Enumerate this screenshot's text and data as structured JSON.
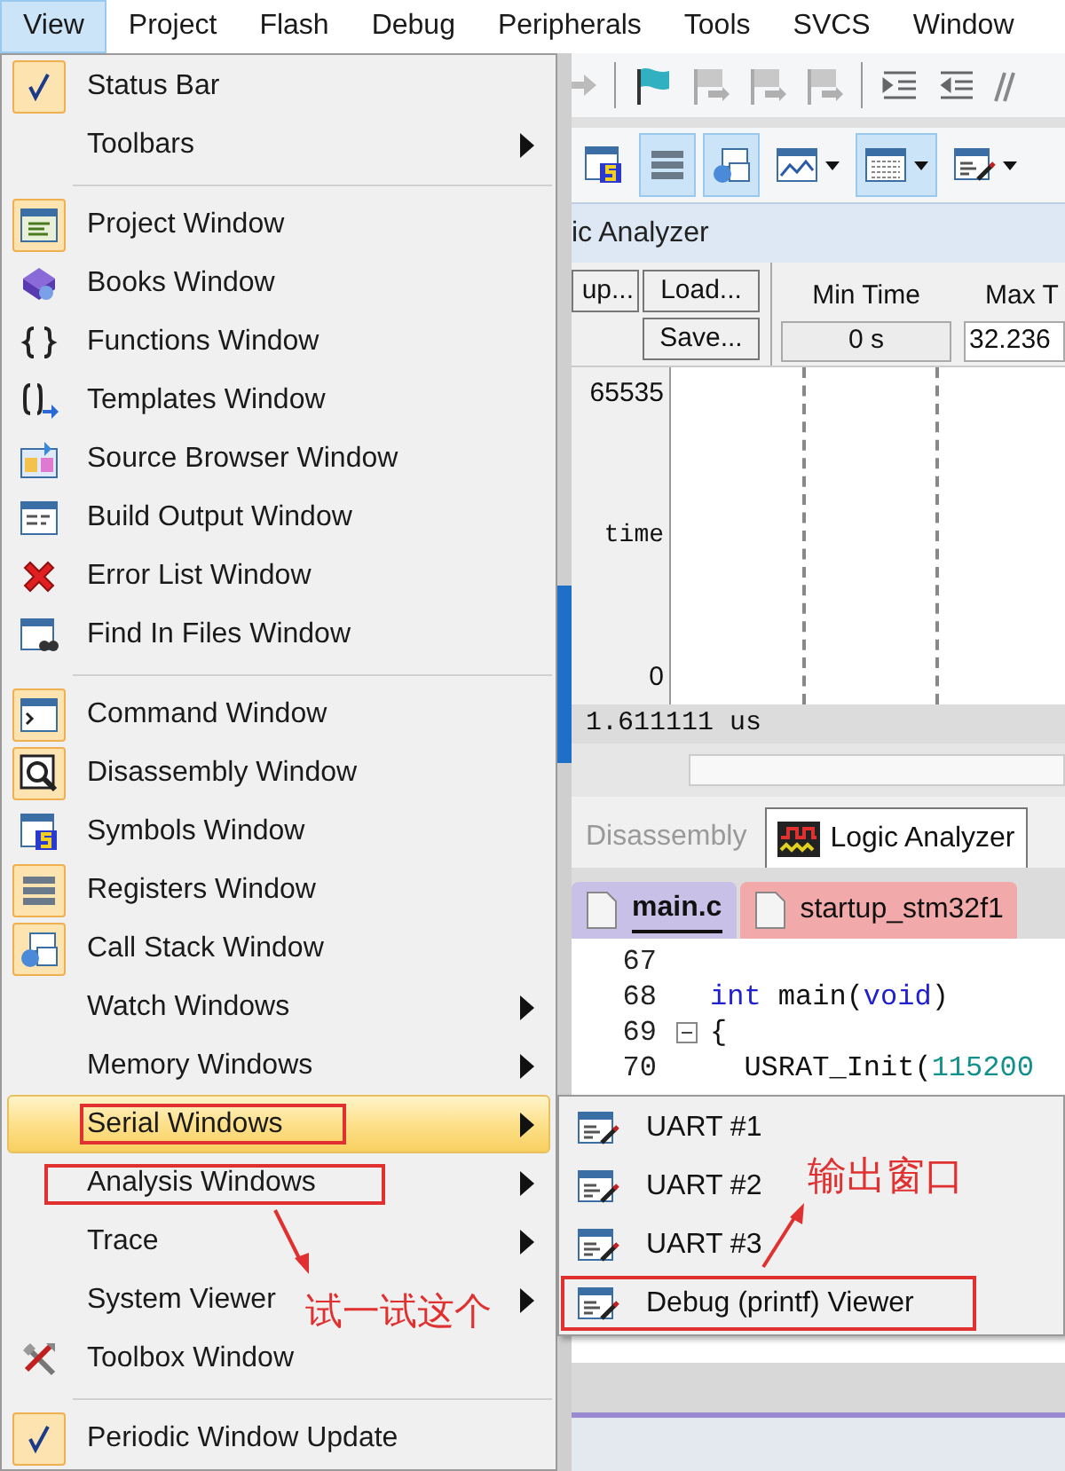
{
  "menu_bar": [
    {
      "label": "View",
      "selected": true
    },
    {
      "label": "Project",
      "selected": false
    },
    {
      "label": "Flash",
      "selected": false
    },
    {
      "label": "Debug",
      "selected": false
    },
    {
      "label": "Peripherals",
      "selected": false
    },
    {
      "label": "Tools",
      "selected": false
    },
    {
      "label": "SVCS",
      "selected": false
    },
    {
      "label": "Window",
      "selected": false
    }
  ],
  "view_menu": {
    "groups": [
      [
        {
          "label": "Status Bar",
          "kind": "command",
          "checked": true,
          "selected": false,
          "outlined": false
        },
        {
          "label": "Toolbars",
          "kind": "submenu",
          "checked": false,
          "selected": false,
          "outlined": false
        }
      ],
      [
        {
          "label": "Project Window",
          "kind": "command",
          "checked": true,
          "selected": false,
          "outlined": false
        },
        {
          "label": "Books Window",
          "kind": "command",
          "checked": false,
          "selected": false,
          "outlined": false
        },
        {
          "label": "Functions Window",
          "kind": "command",
          "checked": false,
          "selected": false,
          "outlined": false
        },
        {
          "label": "Templates Window",
          "kind": "command",
          "checked": false,
          "selected": false,
          "outlined": false
        },
        {
          "label": "Source Browser Window",
          "kind": "command",
          "checked": false,
          "selected": false,
          "outlined": false
        },
        {
          "label": "Build Output Window",
          "kind": "command",
          "checked": false,
          "selected": false,
          "outlined": false
        },
        {
          "label": "Error List Window",
          "kind": "command",
          "checked": false,
          "selected": false,
          "outlined": false
        },
        {
          "label": "Find In Files Window",
          "kind": "command",
          "checked": false,
          "selected": false,
          "outlined": false
        }
      ],
      [
        {
          "label": "Command Window",
          "kind": "command",
          "checked": true,
          "selected": false,
          "outlined": false
        },
        {
          "label": "Disassembly Window",
          "kind": "command",
          "checked": true,
          "selected": false,
          "outlined": false
        },
        {
          "label": "Symbols Window",
          "kind": "command",
          "checked": false,
          "selected": false,
          "outlined": false
        },
        {
          "label": "Registers Window",
          "kind": "command",
          "checked": true,
          "selected": false,
          "outlined": false
        },
        {
          "label": "Call Stack Window",
          "kind": "command",
          "checked": true,
          "selected": false,
          "outlined": false
        },
        {
          "label": "Watch Windows",
          "kind": "submenu",
          "checked": false,
          "selected": false,
          "outlined": false
        },
        {
          "label": "Memory Windows",
          "kind": "submenu",
          "checked": false,
          "selected": false,
          "outlined": false
        },
        {
          "label": "Serial Windows",
          "kind": "submenu",
          "checked": false,
          "selected": true,
          "outlined": true
        },
        {
          "label": "Analysis Windows",
          "kind": "submenu",
          "checked": false,
          "selected": false,
          "outlined": true
        },
        {
          "label": "Trace",
          "kind": "submenu",
          "checked": false,
          "selected": false,
          "outlined": false
        },
        {
          "label": "System Viewer",
          "kind": "submenu",
          "checked": false,
          "selected": false,
          "outlined": false
        },
        {
          "label": "Toolbox Window",
          "kind": "command",
          "checked": false,
          "selected": false,
          "outlined": false
        }
      ],
      [
        {
          "label": "Periodic Window Update",
          "kind": "command",
          "checked": true,
          "selected": false,
          "outlined": false
        }
      ]
    ]
  },
  "serial_submenu": [
    {
      "label": "UART #1",
      "outlined": false
    },
    {
      "label": "UART #2",
      "outlined": false
    },
    {
      "label": "UART #3",
      "outlined": false
    },
    {
      "label": "Debug (printf) Viewer",
      "outlined": true
    }
  ],
  "toolbar_2": [
    {
      "pressed": false
    },
    {
      "pressed": true
    },
    {
      "pressed": true
    },
    {
      "pressed": false
    },
    {
      "pressed": true
    },
    {
      "pressed": false
    }
  ],
  "logic_analyzer": {
    "title": "ic Analyzer",
    "setup_button": "up...",
    "load_button": "Load...",
    "save_button": "Save...",
    "min_time_label": "Min Time",
    "min_time": "0 s",
    "max_time_label": "Max T",
    "max_time": "32.236",
    "signal_max": "65535",
    "signal_name": "time",
    "signal_min": "0",
    "time_readout": "1.611111 us"
  },
  "panel_tabs": [
    {
      "label": "Disassembly",
      "selected": false
    },
    {
      "label": "Logic Analyzer",
      "selected": true
    }
  ],
  "file_tabs": [
    {
      "label": "main.c",
      "selected": true,
      "color": "#c9c0e8"
    },
    {
      "label": "startup_stm32f1",
      "selected": false,
      "color": "#f2a9a9"
    }
  ],
  "code_lines": [
    {
      "number": "67",
      "fold": false
    },
    {
      "number": "68",
      "fold": false,
      "tokens": [
        {
          "text": "int",
          "kind": "keyword"
        },
        {
          "text": " main(",
          "kind": "plain"
        },
        {
          "text": "void",
          "kind": "keyword"
        },
        {
          "text": ")",
          "kind": "plain"
        }
      ]
    },
    {
      "number": "69",
      "fold": true,
      "tokens": [
        {
          "text": "{",
          "kind": "plain"
        }
      ]
    },
    {
      "number": "70",
      "fold": false,
      "tokens": [
        {
          "text": "  USRAT_Init(",
          "kind": "plain"
        },
        {
          "text": "115200",
          "kind": "number"
        }
      ]
    }
  ],
  "annotations": [
    {
      "text": "试一试这个"
    },
    {
      "text": "输出窗口"
    }
  ]
}
